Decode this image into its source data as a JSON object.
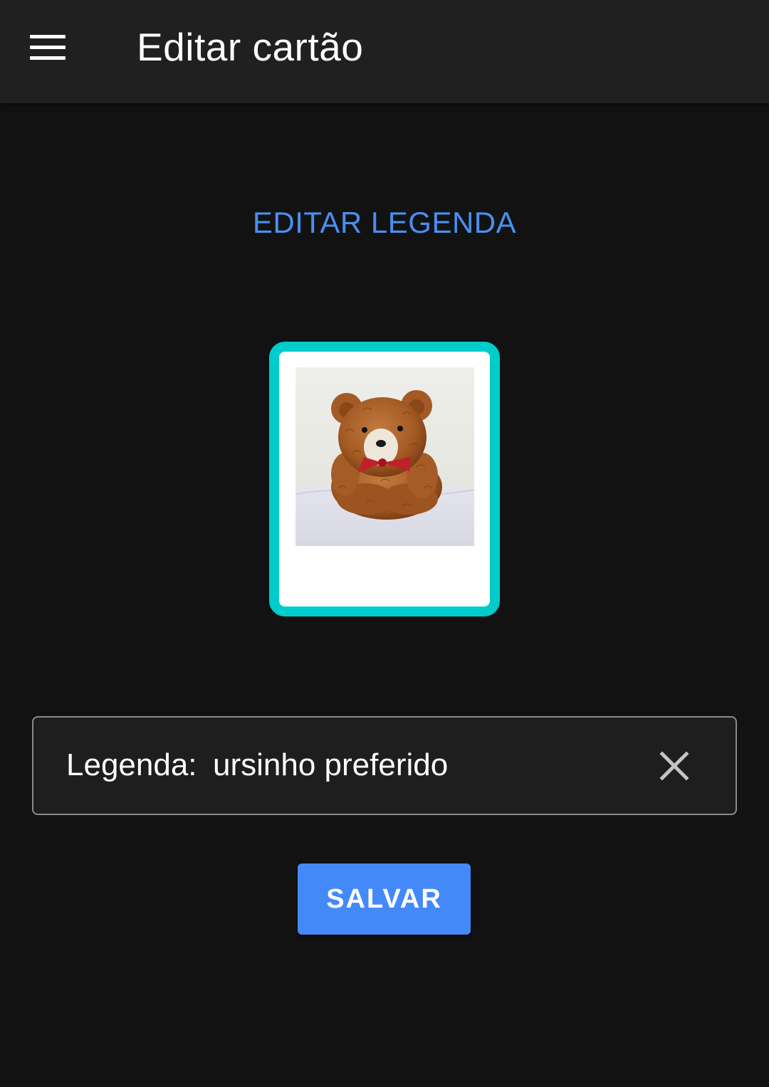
{
  "app_bar": {
    "title": "Editar cartão",
    "menu_icon": "hamburger-menu-icon"
  },
  "main": {
    "heading": "EDITAR LEGENDA",
    "card": {
      "photo": "teddy-bear-photo",
      "border_color": "#00cccc"
    },
    "caption": {
      "label": "Legenda:",
      "value": "ursinho preferido",
      "clear_icon": "close-icon"
    },
    "save_label": "SALVAR"
  },
  "colors": {
    "background": "#121212",
    "app_bar": "#202020",
    "accent_text": "#4a8ff0",
    "button": "#4489f8",
    "card_border": "#00cccc"
  }
}
